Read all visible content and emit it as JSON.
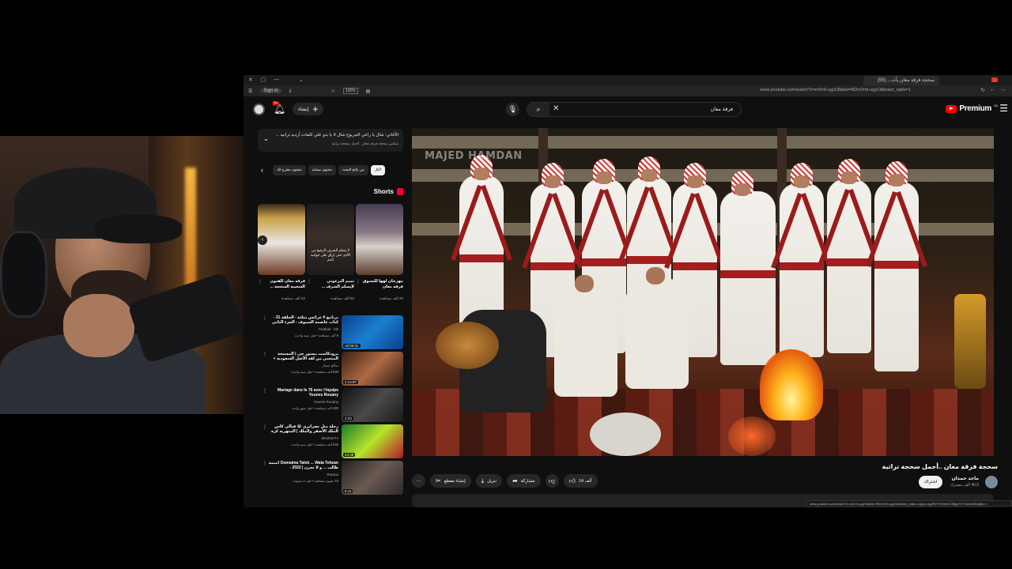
{
  "browser": {
    "tab_title": "سحجة فرقة معان يأت... (55)",
    "signin_label": "Sign in",
    "zoom_label": "120%",
    "url": "www.youtube.com/watch?v=nOrr9-ugyC8&list=RDnOrr9-ugyC8&start_radio=1"
  },
  "masthead": {
    "create_label": "إنشاء",
    "notification_count": "9+",
    "search_query": "فرقة معان",
    "premium_label": "Premium",
    "region": "SA"
  },
  "player": {
    "watermark": "MAJED HAMDAN"
  },
  "video": {
    "title": "سحجة فرقة معان ..أجمل سحجة تراثية",
    "channel_name": "ماجد حمدان",
    "subscribers": "40.5 ألف مشترك",
    "subscribe_label": "اشتراك",
    "like_count": "14 ألف",
    "share_label": "مشاركة",
    "download_label": "تنزيل",
    "clip_label": "إنشاء مقطع"
  },
  "status_bar_url": "www.youtube.com/watch?v=nOrr9-ugyC8&list=RDnOrr9-ugyC8&start_radio=1&pp=oygIR2YHVmhvC3Bg2YXYrkdmZ6egBw==",
  "sidebar": {
    "notice": {
      "line1": "الأغاني: شال يا راعي الجربوع شال لا يا بدو علي كلمات أرديه ترانيه ...",
      "line2": "ميكس سحجة فرقة معان ..أجمل سحجة تراثية"
    },
    "chips": [
      "الكل",
      "من نتائج البحث",
      "محتوى مشابه",
      "محتوى مقترح لك"
    ],
    "shorts_title": "Shorts",
    "shorts": [
      {
        "title": "مهرجان لهها للتسوق فرقة معان",
        "views": "20 ألف مشاهدة"
      },
      {
        "title": "تميم البرغوثي لإيسلم الشرف ...",
        "views": "92 ألف مشاهدة",
        "overlay": "لا يسلم الشرف الرفيع من الأذى حتى يُراق على جوانبه الدم"
      },
      {
        "title": "فرقة معان للفنون الشعبية السحجة ...",
        "views": "42 ألف مشاهدة"
      }
    ],
    "related": [
      {
        "title": "برنامج # عرائس مثلثة - الحلقة 31 - كتاب عاصمة السيوف - الجزء الثاني",
        "channel": "Kitabuk - ktk",
        "meta": "9 ألف مشاهدة • قبل سنة واحدة",
        "duration": "10:00:01"
      },
      {
        "title": "برودكاست ببسور جي | المسبحة المتحيي من لقد الأصل السعودية + راكان الدخاوي",
        "channel": "صالح سمار",
        "meta": "630 ألف مشاهدة • قبل سنة واحدة",
        "duration": "2:14:57"
      },
      {
        "title": "Mariage dans le 76 avec l'équipe Younes Rouany",
        "channel": "Younes Rouany",
        "meta": "480 ألف مشاهدة • قبل شهر واحد",
        "duration": "2:23"
      },
      {
        "title": "رحلة مثل نصرابري 😂 فيالي كأس الملك الأصفر والملك | المتهرية كرة القدم 💔",
        "channel": "MesharrTv",
        "meta": "535 ألف مشاهدة • قبل سنة واحدة",
        "duration": "44:39"
      },
      {
        "title": "Oumaima Taleb ... Wala Tehzan أميمة طالب ... و لا تحزن | 2022 -",
        "channel": "Rotana",
        "meta": "15 مليون مشاهدة • قبل 3 سنوات",
        "duration": "5:11"
      }
    ]
  }
}
